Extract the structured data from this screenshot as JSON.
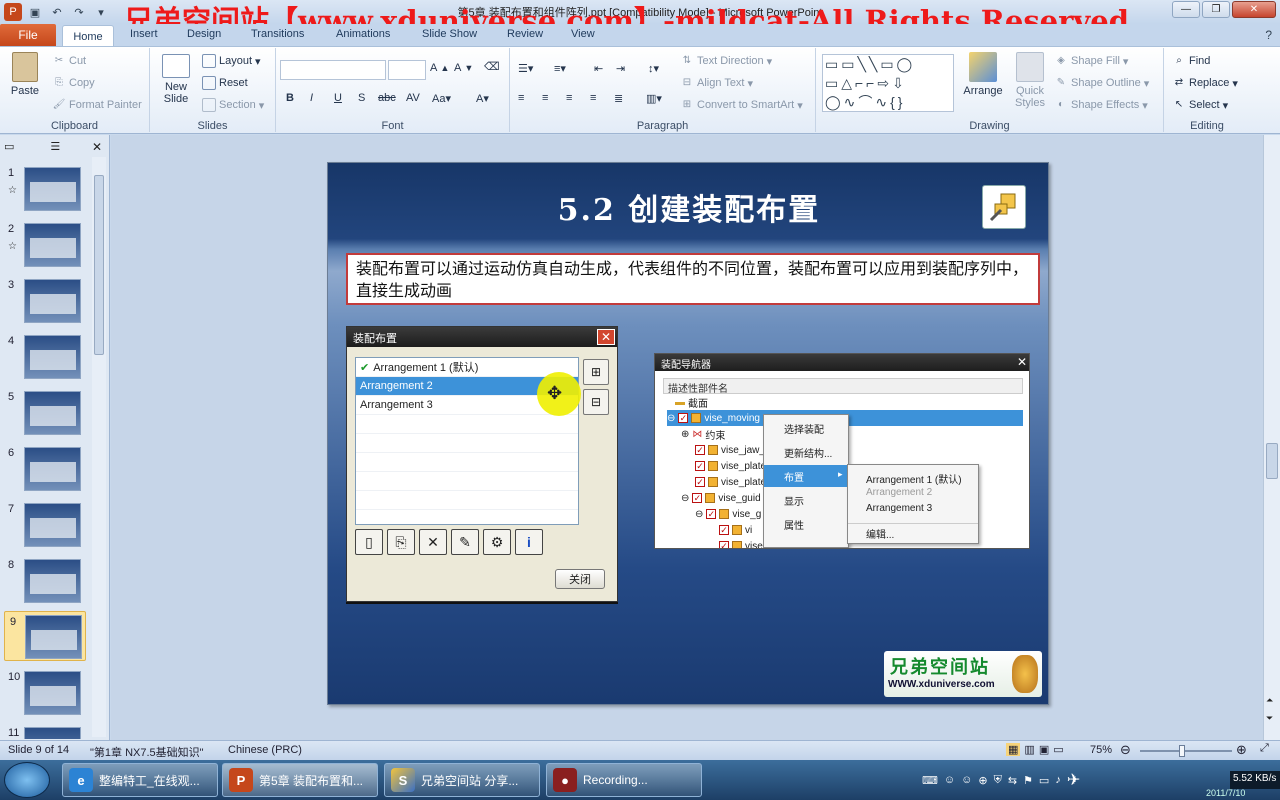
{
  "window": {
    "doc_title": "第5章 装配布置和组件阵列.ppt [Compatibility Mode] - Microsoft PowerPoint",
    "watermark": "兄弟空间站【www.xduniverse.com】-mildcat-All Rights Reserved"
  },
  "tabs": [
    "File",
    "Home",
    "Insert",
    "Design",
    "Transitions",
    "Animations",
    "Slide Show",
    "Review",
    "View"
  ],
  "ribbon": {
    "clipboard": {
      "label": "Clipboard",
      "paste": "Paste",
      "cut": "Cut",
      "copy": "Copy",
      "format_painter": "Format Painter"
    },
    "slides": {
      "label": "Slides",
      "new_slide": "New Slide",
      "layout": "Layout",
      "reset": "Reset",
      "section": "Section"
    },
    "font": {
      "label": "Font"
    },
    "paragraph": {
      "label": "Paragraph",
      "text_direction": "Text Direction",
      "align_text": "Align Text",
      "convert_smartart": "Convert to SmartArt"
    },
    "drawing": {
      "label": "Drawing",
      "arrange": "Arrange",
      "quick_styles": "Quick Styles",
      "shape_fill": "Shape Fill",
      "shape_outline": "Shape Outline",
      "shape_effects": "Shape Effects"
    },
    "editing": {
      "label": "Editing",
      "find": "Find",
      "replace": "Replace",
      "select": "Select"
    }
  },
  "thumbnails": [
    "1",
    "2",
    "3",
    "4",
    "5",
    "6",
    "7",
    "8",
    "9",
    "10",
    "11"
  ],
  "slide": {
    "title": "5.2  创建装配布置",
    "body_text": "装配布置可以通过运动仿真自动生成，代表组件的不同位置，装配布置可以应用到装配序列中，直接生成动画",
    "dialog": {
      "title": "装配布置",
      "items": [
        "Arrangement 1 (默认)",
        "Arrangement 2",
        "Arrangement 3"
      ],
      "close_button": "关闭"
    },
    "navigator": {
      "title": "装配导航器",
      "header": "描述性部件名",
      "rows": [
        "截面",
        "vise_moving",
        "约束",
        "vise_jaw_",
        "vise_plate",
        "vise_plate",
        "vise_guid",
        "vise_g",
        "vi",
        "vise_bushing"
      ],
      "context_menu": [
        "选择装配",
        "更新结构...",
        "布置",
        "显示",
        "属性"
      ],
      "submenu": [
        "Arrangement 1 (默认)",
        "Arrangement 2",
        "Arrangement 3",
        "编辑..."
      ]
    },
    "logo": {
      "cn": "兄弟空间站",
      "en": "WWW.xduniverse.com"
    }
  },
  "statusbar": {
    "slide_info": "Slide 9 of 14",
    "theme": "\"第1章 NX7.5基础知识\"",
    "language": "Chinese (PRC)",
    "zoom": "75%",
    "zoom_level": 0.45
  },
  "taskbar": {
    "items": [
      "整编特工_在线观...",
      "第5章 装配布置和...",
      "兄弟空间站 分享...",
      "Recording..."
    ],
    "net_speed": "5.52 KB/s",
    "clock": "2011/7/10"
  },
  "colors": {
    "accent": "#c5471b",
    "slide_bg": "#22457d",
    "selection": "#3d92d9"
  }
}
